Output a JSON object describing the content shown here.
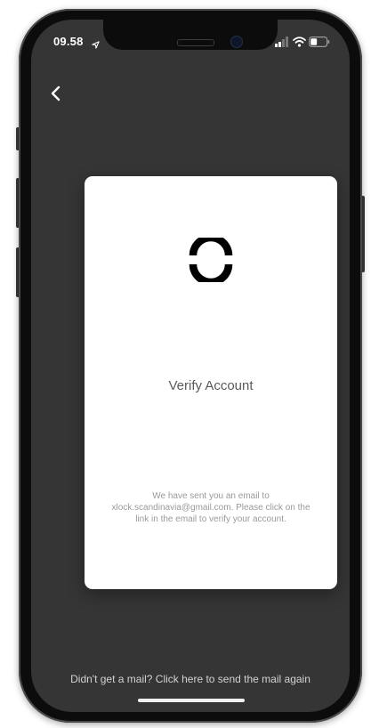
{
  "status_bar": {
    "time": "09.58",
    "location_icon": "location-arrow-icon",
    "signal_icon": "cellular-signal-icon",
    "wifi_icon": "wifi-icon",
    "battery_icon": "battery-icon"
  },
  "header": {
    "back_icon": "chevron-left-icon"
  },
  "card": {
    "logo_icon": "brand-logo-icon",
    "title": "Verify Account",
    "message": "We have sent you an email to xlock.scandinavia@gmail.com. Please click on the link in the email to verify your account."
  },
  "footer": {
    "resend_link": "Didn't get a mail? Click here to send the mail again"
  },
  "colors": {
    "screen_background": "#353535",
    "card_background": "#ffffff",
    "text_light": "#d2d2d2",
    "title_text": "#5a5a5a",
    "message_text": "#9a9a9a"
  }
}
